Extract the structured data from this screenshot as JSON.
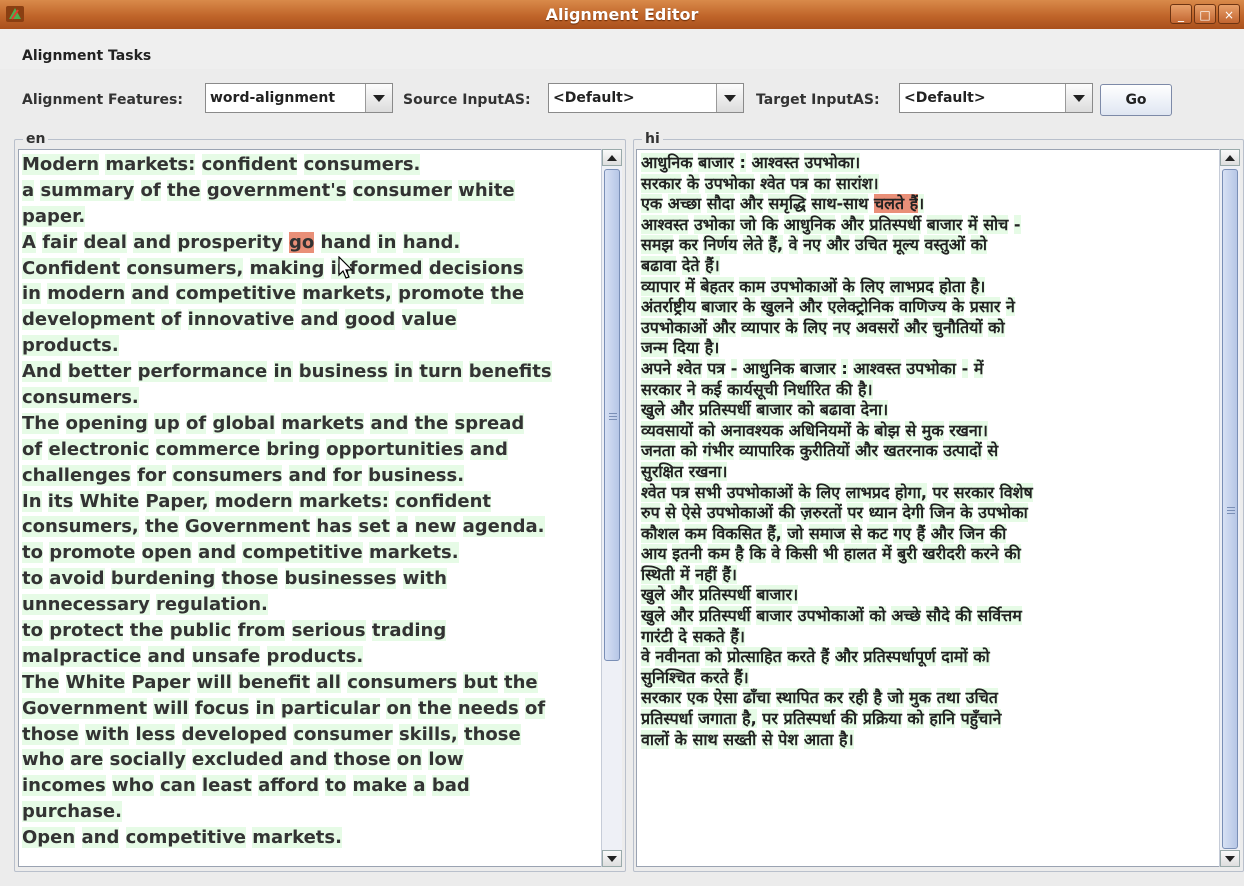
{
  "window": {
    "title": "Alignment Editor"
  },
  "menu": {
    "items": [
      "Alignment Tasks"
    ]
  },
  "toolbar": {
    "features_label": "Alignment Features:",
    "features_value": "word-alignment",
    "source_label": "Source InputAS:",
    "source_value": "<Default>",
    "target_label": "Target InputAS:",
    "target_value": "<Default>",
    "go_label": "Go"
  },
  "panels": {
    "source": {
      "label": "en",
      "lines": [
        "Modern markets:  confident consumers.",
        "a summary of the government's consumer white",
        "paper.",
        "A fair deal and prosperity go hand in hand.",
        "Confident consumers,  making informed decisions",
        "in modern and competitive markets,  promote the",
        "development of innovative and good value",
        "products.",
        "And better performance in business in turn benefits",
        "consumers.",
        "The opening up of global markets and the spread",
        "of electronic commerce bring opportunities and",
        "challenges for consumers and for business.",
        "In its White Paper,  modern markets:  confident",
        "consumers,  the Government has set a new agenda.",
        "to promote open and competitive markets.",
        "to avoid burdening those businesses with",
        "unnecessary regulation.",
        "to protect the public from serious trading",
        "malpractice and unsafe products.",
        "The White Paper will benefit all consumers but the",
        "Government will focus in particular on the needs of",
        "those with less developed consumer skills,  those",
        "who are socially excluded and those on low",
        "incomes who can least afford to make a bad",
        "purchase.",
        "Open and competitive markets."
      ],
      "highlight": {
        "line": 3,
        "word": "go"
      }
    },
    "target": {
      "label": "hi",
      "lines": [
        "आधुनिक बाजार :  आश्वस्त उपभोका।",
        "सरकार के उपभोका श्वेत पत्र का सारांश।",
        "एक अच्छा सौदा और समृद्धि साथ-साथ चलते हैं।",
        "आश्वस्त उभोका  जो कि आधुनिक और प्रतिस्पर्धी बाजार में सोच -",
        "समझ कर निर्णय लेते हैं,  वे नए और उचित  मूल्य वस्तुओं को",
        "बढावा देते हैं।",
        "व्यापार में बेहतर काम उपभोकाओं के लिए  लाभप्रद होता है।",
        "अंतर्राष्ट्रीय बाजार के खुलने और एलेक्ट्रोनिक वाणिज्य के प्रसार ने",
        "उपभोकाओं  और व्यापार के लिए नए अवसरों और चुनौतियों को",
        "जन्म दिया है।",
        "अपने श्वेत पत्र  - आधुनिक बाजार :  आश्वस्त उपभोका - में",
        "सरकार ने कई कार्यसूची निर्धारित की है।",
        "खुले और प्रतिस्पर्धी बाजार को बढावा देना।",
        "व्यवसायों को अनावश्यक अधिनियमों के बोझ से मुक रखना।",
        "जनता को गंभीर व्यापारिक कुरीतियों और खतरनाक उत्पादों से",
        "सुरक्षित रखना।",
        "श्वेत पत्र सभी उपभोकाओं के लिए लाभप्रद होगा,  पर सरकार विशेष",
        "रुप से ऐसे  उपभोकाओं की ज़रुरतों पर ध्यान देगी जिन के उपभोका",
        "कौशल कम विकसित हैं,  जो समाज  से कट गए हैं और जिन की",
        "आय इतनी कम है कि वे किसी भी हालत में बुरी खरीदरी करने की",
        "स्थिती में नहीं हैं।",
        "खुले और प्रतिस्पर्धी बाजार।",
        "खुले और प्रतिस्पर्धी बाजार उपभोकाओं को अच्छे सौदे की सर्वित्तम",
        "गारंटी दे  सकते हैं।",
        "वे नवीनता को प्रोत्साहित करते हैं और प्रतिस्पर्धापूर्ण दामों को",
        "सुनिश्चित करते हैं।",
        "सरकार एक ऐसा ढाँचा स्थापित कर रही है जो मुक तथा  उचित",
        "प्रतिस्पर्धा जगाता है,  पर प्रतिस्पर्धा की प्रक्रिया को हानि पहुँचाने",
        "वालों के साथ  सख्ती से पेश आता है।"
      ],
      "highlight": {
        "line": 2,
        "word": "चलते हैं"
      }
    }
  },
  "colors": {
    "token_bg": "#e6fbe6",
    "highlight_bg": "#e98f78",
    "titlebar": "#c0652a"
  }
}
